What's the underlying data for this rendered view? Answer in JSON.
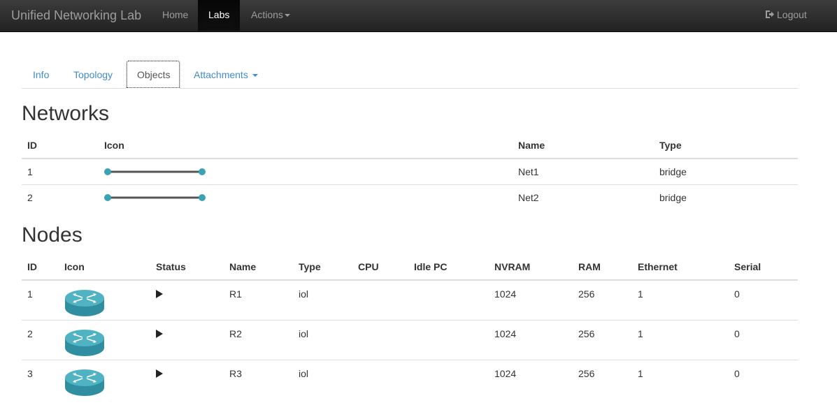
{
  "navbar": {
    "brand": "Unified Networking Lab",
    "items": [
      {
        "label": "Home"
      },
      {
        "label": "Labs"
      },
      {
        "label": "Actions"
      }
    ],
    "logout": "Logout"
  },
  "tabs": [
    {
      "label": "Info"
    },
    {
      "label": "Topology"
    },
    {
      "label": "Objects"
    },
    {
      "label": "Attachments"
    }
  ],
  "networks": {
    "heading": "Networks",
    "columns": [
      "ID",
      "Icon",
      "Name",
      "Type"
    ],
    "rows": [
      {
        "id": "1",
        "name": "Net1",
        "type": "bridge"
      },
      {
        "id": "2",
        "name": "Net2",
        "type": "bridge"
      }
    ]
  },
  "nodes": {
    "heading": "Nodes",
    "columns": [
      "ID",
      "Icon",
      "Status",
      "Name",
      "Type",
      "CPU",
      "Idle PC",
      "NVRAM",
      "RAM",
      "Ethernet",
      "Serial"
    ],
    "rows": [
      {
        "id": "1",
        "name": "R1",
        "type": "iol",
        "cpu": "",
        "idlepc": "",
        "nvram": "1024",
        "ram": "256",
        "ethernet": "1",
        "serial": "0"
      },
      {
        "id": "2",
        "name": "R2",
        "type": "iol",
        "cpu": "",
        "idlepc": "",
        "nvram": "1024",
        "ram": "256",
        "ethernet": "1",
        "serial": "0"
      },
      {
        "id": "3",
        "name": "R3",
        "type": "iol",
        "cpu": "",
        "idlepc": "",
        "nvram": "1024",
        "ram": "256",
        "ethernet": "1",
        "serial": "0"
      }
    ]
  },
  "colors": {
    "accent": "#428bca",
    "network_icon": "#3ba2b5",
    "router_icon": "#3ba2b5"
  },
  "icons": {
    "network": "network-link-icon",
    "router": "router-icon",
    "status": "play-icon",
    "logout": "logout-icon"
  }
}
